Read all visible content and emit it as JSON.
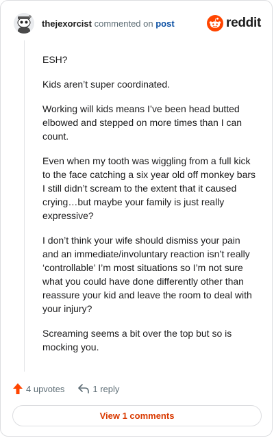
{
  "header": {
    "username": "thejexorcist",
    "action_text": "commented on",
    "target_text": "post",
    "brand": "reddit"
  },
  "comment": {
    "paragraphs": [
      "ESH?",
      "Kids aren’t super coordinated.",
      "Working will kids means I’ve been head butted elbowed and stepped on more times than I can count.",
      "Even when my tooth was wiggling from a full kick to the face catching a six year old off monkey bars I still didn’t scream to the extent that it caused crying…but maybe your family is just really expressive?",
      "I don’t think your wife should dismiss your pain and an immediate/involuntary reaction isn’t really ‘controllable’ I’m most situations so I’m not sure what you could have done differently other than reassure your kid and leave the room to deal with your injury?",
      "Screaming seems a bit over the top but so is mocking you."
    ]
  },
  "actions": {
    "upvotes": "4 upvotes",
    "replies": "1 reply"
  },
  "footer": {
    "view_comments": "View 1 comments"
  },
  "colors": {
    "brand_orange": "#ff4500",
    "link_orange": "#d93900",
    "post_link": "#0a4fa3"
  },
  "icons": {
    "avatar": "snoo-avatar-icon",
    "brand": "reddit-logo-icon",
    "upvote": "upvote-arrow-icon",
    "reply": "reply-arrow-icon"
  }
}
